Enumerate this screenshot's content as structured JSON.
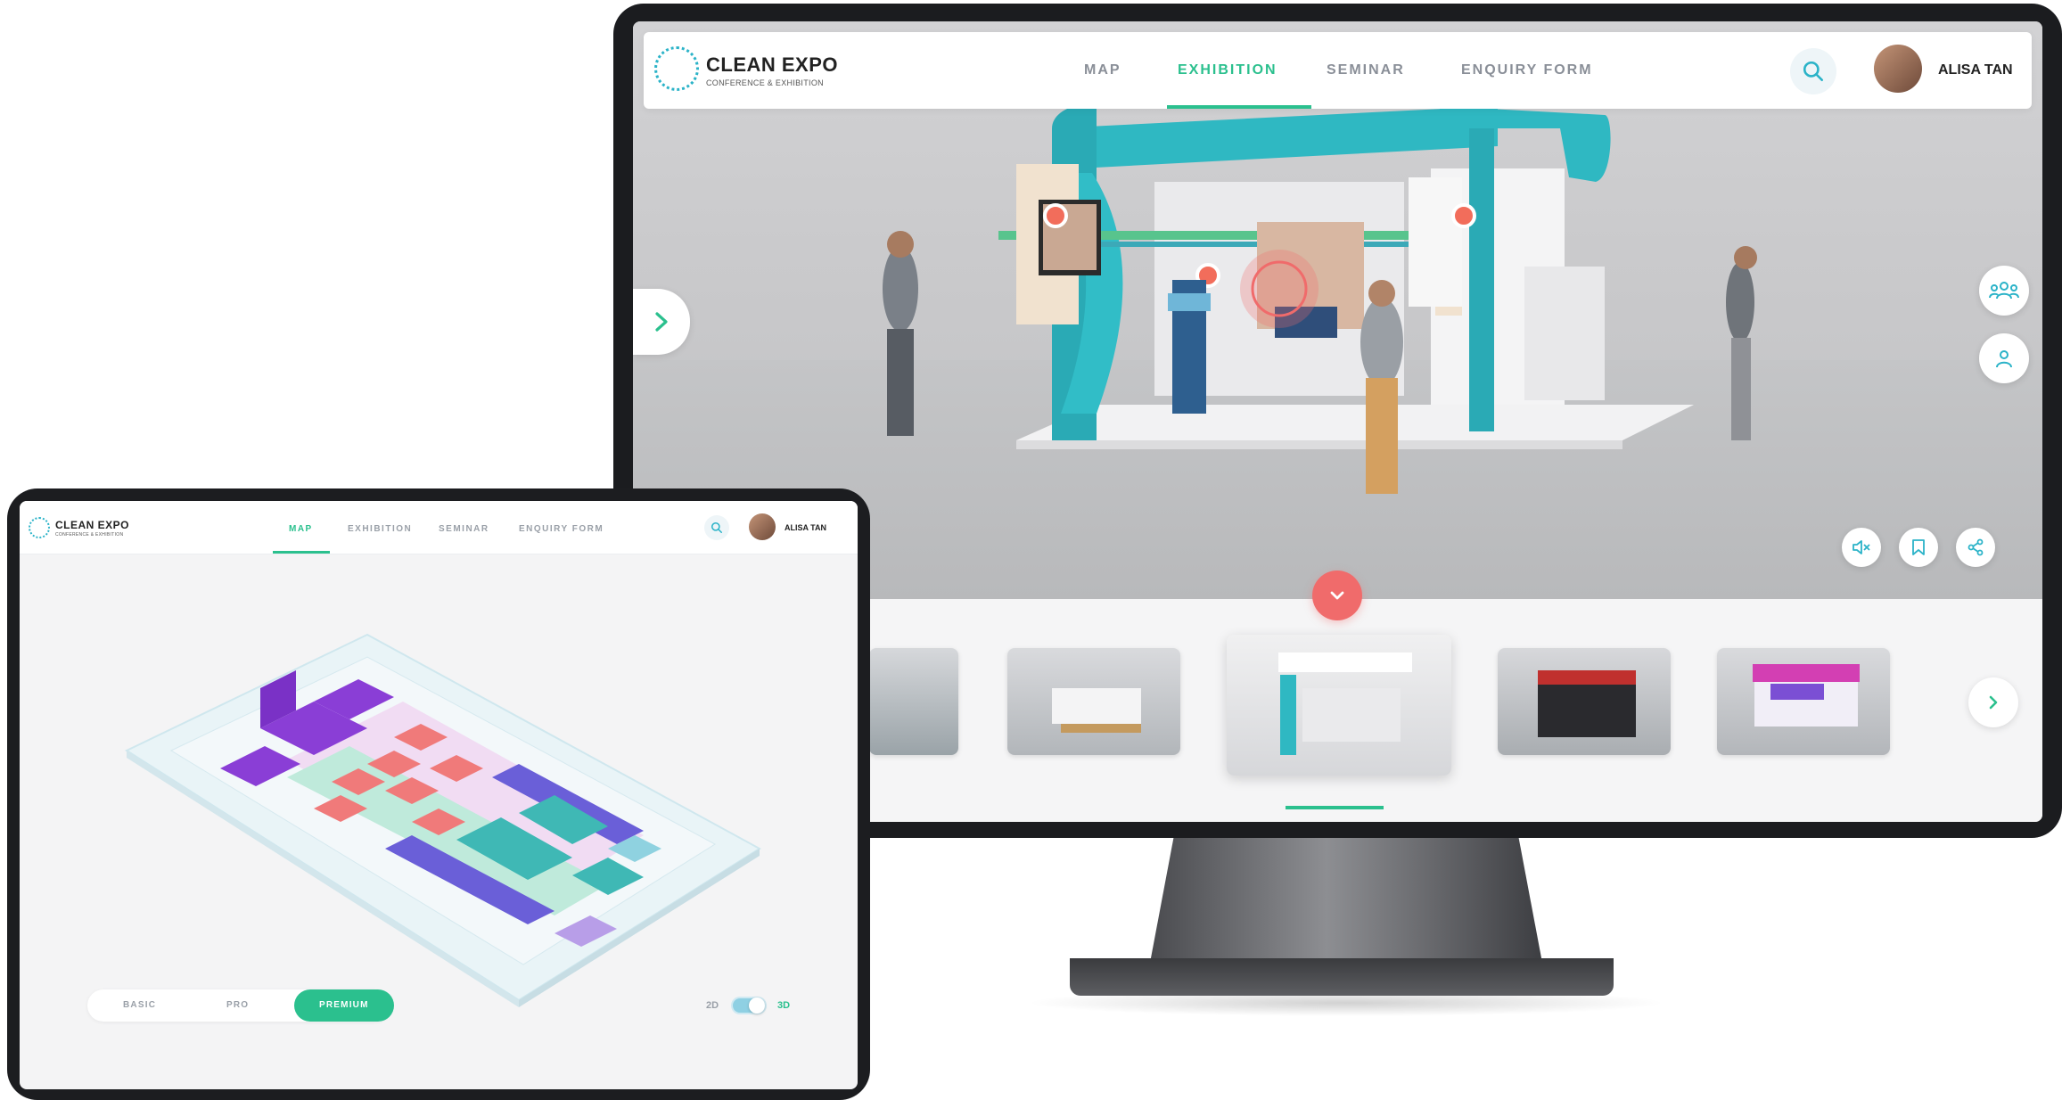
{
  "brand": {
    "title": "CLEAN EXPO",
    "subtitle": "CONFERENCE & EXHIBITION"
  },
  "monitor": {
    "tabs": [
      {
        "label": "MAP",
        "active": false
      },
      {
        "label": "EXHIBITION",
        "active": true
      },
      {
        "label": "SEMINAR",
        "active": false
      },
      {
        "label": "ENQUIRY FORM",
        "active": false
      }
    ],
    "user_name": "ALISA TAN",
    "thumbnails": [
      "booth-1",
      "booth-2",
      "booth-3",
      "booth-4",
      "booth-5"
    ],
    "selected_thumbnail": 2
  },
  "tablet": {
    "tabs": [
      {
        "label": "MAP",
        "active": true
      },
      {
        "label": "EXHIBITION",
        "active": false
      },
      {
        "label": "SEMINAR",
        "active": false
      },
      {
        "label": "ENQUIRY FORM",
        "active": false
      }
    ],
    "user_name": "ALISA TAN",
    "tiers": [
      "BASIC",
      "PRO",
      "PREMIUM"
    ],
    "selected_tier": "PREMIUM",
    "view_toggle": {
      "left": "2D",
      "right": "3D",
      "state": "3D"
    }
  },
  "colors": {
    "accent_green": "#2bc08e",
    "accent_teal": "#2bb3c8",
    "alert_red": "#f06b6b",
    "purple": "#8a3ed6",
    "salmon": "#f07a7a",
    "teal_booth": "#3fb8b5",
    "indigo": "#6a5fd8"
  },
  "icons": [
    "search-icon",
    "chevron-right-icon",
    "chevron-down-icon",
    "group-icon",
    "person-icon",
    "mute-icon",
    "bookmark-icon",
    "share-icon"
  ]
}
